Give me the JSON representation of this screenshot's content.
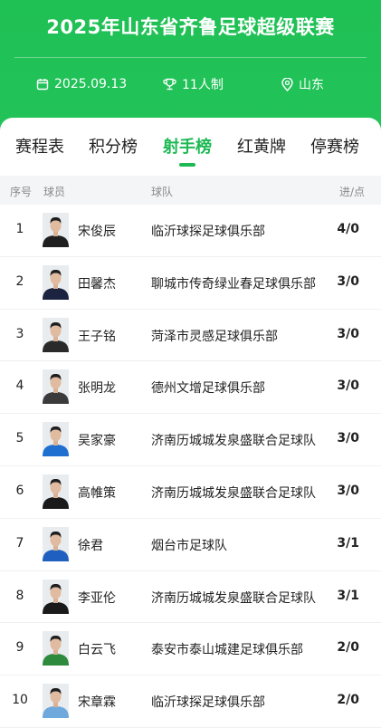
{
  "header": {
    "title": "2025年山东省齐鲁足球超级联赛",
    "date": "2025.09.13",
    "format": "11人制",
    "location": "山东",
    "colors": {
      "brand": "#1fc054",
      "accent": "#1db954"
    }
  },
  "tabs": [
    {
      "label": "赛程表",
      "active": false
    },
    {
      "label": "积分榜",
      "active": false
    },
    {
      "label": "射手榜",
      "active": true
    },
    {
      "label": "红黄牌",
      "active": false
    },
    {
      "label": "停赛榜",
      "active": false
    }
  ],
  "table": {
    "columns": {
      "rank": "序号",
      "player": "球员",
      "team": "球队",
      "score": "进/点"
    },
    "rows": [
      {
        "rank": "1",
        "name": "宋俊辰",
        "team": "临沂球探足球俱乐部",
        "score": "4/0",
        "shirt": "#1f1f1f"
      },
      {
        "rank": "2",
        "name": "田馨杰",
        "team": "聊城市传奇绿业春足球俱乐部",
        "score": "3/0",
        "shirt": "#1c2340"
      },
      {
        "rank": "3",
        "name": "王子铭",
        "team": "菏泽市灵感足球俱乐部",
        "score": "3/0",
        "shirt": "#2a2a2a"
      },
      {
        "rank": "4",
        "name": "张明龙",
        "team": "德州文增足球俱乐部",
        "score": "3/0",
        "shirt": "#3b3b3b"
      },
      {
        "rank": "5",
        "name": "吴家豪",
        "team": "济南历城城发泉盛联合足球队",
        "score": "3/0",
        "shirt": "#1f6fd1"
      },
      {
        "rank": "6",
        "name": "高帷策",
        "team": "济南历城城发泉盛联合足球队",
        "score": "3/0",
        "shirt": "#1a1a1a"
      },
      {
        "rank": "7",
        "name": "徐君",
        "team": "烟台市足球队",
        "score": "3/1",
        "shirt": "#1f5fbf"
      },
      {
        "rank": "8",
        "name": "李亚伦",
        "team": "济南历城城发泉盛联合足球队",
        "score": "3/1",
        "shirt": "#1a1a1a"
      },
      {
        "rank": "9",
        "name": "白云飞",
        "team": "泰安市泰山城建足球俱乐部",
        "score": "2/0",
        "shirt": "#2e8b3e"
      },
      {
        "rank": "10",
        "name": "宋章霖",
        "team": "临沂球探足球俱乐部",
        "score": "2/0",
        "shirt": "#6fa8dc"
      }
    ]
  }
}
